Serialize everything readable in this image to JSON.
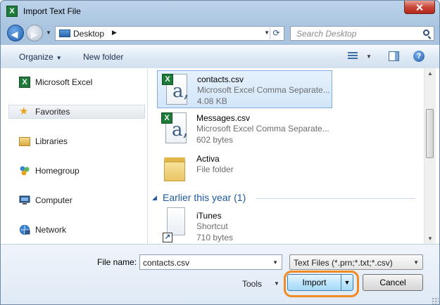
{
  "window": {
    "title": "Import Text File",
    "app_icon": "excel-icon"
  },
  "address": {
    "location": "Desktop"
  },
  "search": {
    "placeholder": "Search Desktop"
  },
  "toolbar": {
    "organize": "Organize",
    "new_folder": "New folder"
  },
  "navpane": {
    "items": [
      {
        "label": "Microsoft Excel",
        "icon": "excel-icon"
      },
      {
        "label": "Favorites",
        "icon": "star-icon"
      },
      {
        "label": "Libraries",
        "icon": "libraries-icon"
      },
      {
        "label": "Homegroup",
        "icon": "homegroup-icon"
      },
      {
        "label": "Computer",
        "icon": "computer-icon"
      },
      {
        "label": "Network",
        "icon": "network-icon"
      }
    ]
  },
  "files": [
    {
      "name": "contacts.csv",
      "type": "Microsoft Excel Comma Separate...",
      "size": "4.08 KB",
      "icon": "csv-file-icon",
      "selected": true
    },
    {
      "name": "Messages.csv",
      "type": "Microsoft Excel Comma Separate...",
      "size": "602 bytes",
      "icon": "csv-file-icon"
    },
    {
      "name": "Activa",
      "type": "File folder",
      "icon": "folder-icon"
    }
  ],
  "groups": [
    {
      "title": "Earlier this year (1)",
      "files": [
        {
          "name": "iTunes",
          "type": "Shortcut",
          "size": "710 bytes",
          "icon": "shortcut-icon"
        }
      ]
    }
  ],
  "bottom": {
    "file_name_label": "File name:",
    "file_name_value": "contacts.csv",
    "file_type": "Text Files (*.prn;*.txt;*.csv)",
    "tools": "Tools",
    "import": "Import",
    "cancel": "Cancel"
  },
  "colors": {
    "highlight": "#f08a24",
    "selection": "#d2e6fa",
    "group_title": "#1e5aa0"
  }
}
